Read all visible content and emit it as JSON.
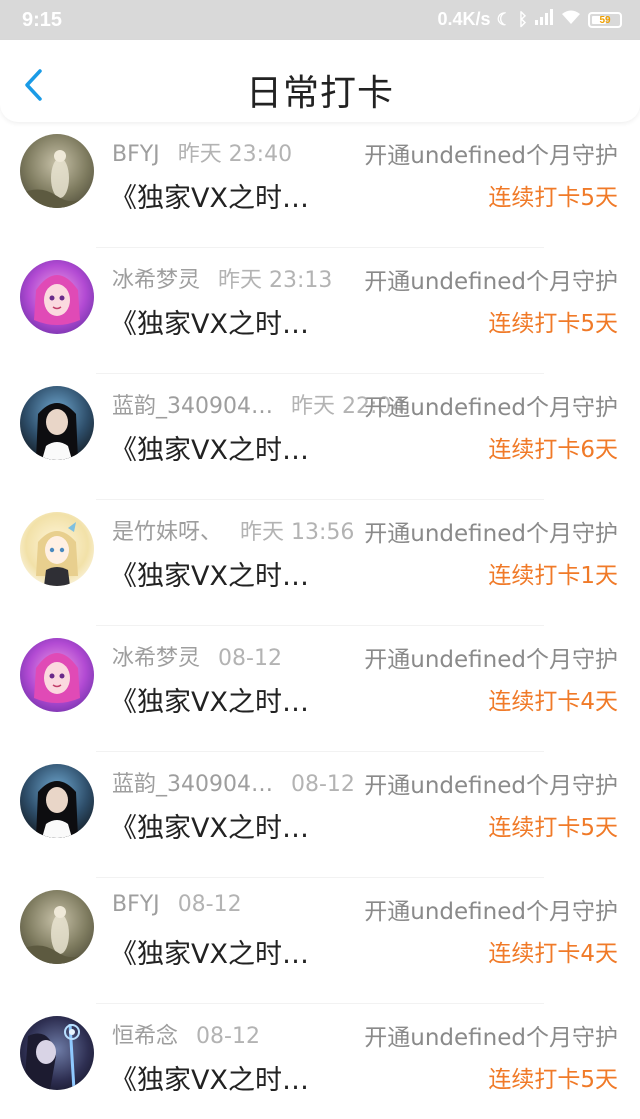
{
  "status_bar": {
    "time": "9:15",
    "speed": "0.4K/s",
    "battery": "59"
  },
  "header": {
    "title": "日常打卡",
    "back_icon": "chevron-left-icon"
  },
  "colors": {
    "accent": "#1a9be6",
    "streak": "#f07a28",
    "status_bar_bg": "#d9d9d9"
  },
  "items": [
    {
      "name": "BFYJ",
      "time": "昨天 23:40",
      "action": "开通undefined个月守护",
      "title": "《独家VX之时…",
      "streak": "连续打卡5天",
      "avatar": "avatar-1"
    },
    {
      "name": "冰希梦灵",
      "time": "昨天 23:13",
      "action": "开通undefined个月守护",
      "title": "《独家VX之时…",
      "streak": "连续打卡5天",
      "avatar": "avatar-2"
    },
    {
      "name": "蓝韵_340904…",
      "time": "昨天 22:04",
      "action": "开通undefined个月守护",
      "title": "《独家VX之时…",
      "streak": "连续打卡6天",
      "avatar": "avatar-3"
    },
    {
      "name": "是竹妹呀、",
      "time": "昨天 13:56",
      "action": "开通undefined个月守护",
      "title": "《独家VX之时…",
      "streak": "连续打卡1天",
      "avatar": "avatar-4"
    },
    {
      "name": "冰希梦灵",
      "time": "08-12",
      "action": "开通undefined个月守护",
      "title": "《独家VX之时…",
      "streak": "连续打卡4天",
      "avatar": "avatar-2"
    },
    {
      "name": "蓝韵_340904…",
      "time": "08-12",
      "action": "开通undefined个月守护",
      "title": "《独家VX之时…",
      "streak": "连续打卡5天",
      "avatar": "avatar-3"
    },
    {
      "name": "BFYJ",
      "time": "08-12",
      "action": "开通undefined个月守护",
      "title": "《独家VX之时…",
      "streak": "连续打卡4天",
      "avatar": "avatar-1"
    },
    {
      "name": "恒希念",
      "time": "08-12",
      "action": "开通undefined个月守护",
      "title": "《独家VX之时…",
      "streak": "连续打卡5天",
      "avatar": "avatar-5"
    }
  ]
}
